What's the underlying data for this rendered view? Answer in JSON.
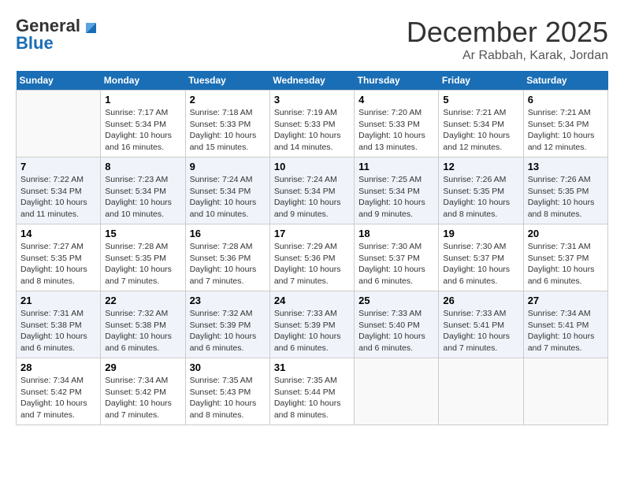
{
  "header": {
    "logo_general": "General",
    "logo_blue": "Blue",
    "month_title": "December 2025",
    "subtitle": "Ar Rabbah, Karak, Jordan"
  },
  "weekdays": [
    "Sunday",
    "Monday",
    "Tuesday",
    "Wednesday",
    "Thursday",
    "Friday",
    "Saturday"
  ],
  "weeks": [
    [
      {
        "day": "",
        "info": ""
      },
      {
        "day": "1",
        "info": "Sunrise: 7:17 AM\nSunset: 5:34 PM\nDaylight: 10 hours\nand 16 minutes."
      },
      {
        "day": "2",
        "info": "Sunrise: 7:18 AM\nSunset: 5:33 PM\nDaylight: 10 hours\nand 15 minutes."
      },
      {
        "day": "3",
        "info": "Sunrise: 7:19 AM\nSunset: 5:33 PM\nDaylight: 10 hours\nand 14 minutes."
      },
      {
        "day": "4",
        "info": "Sunrise: 7:20 AM\nSunset: 5:33 PM\nDaylight: 10 hours\nand 13 minutes."
      },
      {
        "day": "5",
        "info": "Sunrise: 7:21 AM\nSunset: 5:34 PM\nDaylight: 10 hours\nand 12 minutes."
      },
      {
        "day": "6",
        "info": "Sunrise: 7:21 AM\nSunset: 5:34 PM\nDaylight: 10 hours\nand 12 minutes."
      }
    ],
    [
      {
        "day": "7",
        "info": "Sunrise: 7:22 AM\nSunset: 5:34 PM\nDaylight: 10 hours\nand 11 minutes."
      },
      {
        "day": "8",
        "info": "Sunrise: 7:23 AM\nSunset: 5:34 PM\nDaylight: 10 hours\nand 10 minutes."
      },
      {
        "day": "9",
        "info": "Sunrise: 7:24 AM\nSunset: 5:34 PM\nDaylight: 10 hours\nand 10 minutes."
      },
      {
        "day": "10",
        "info": "Sunrise: 7:24 AM\nSunset: 5:34 PM\nDaylight: 10 hours\nand 9 minutes."
      },
      {
        "day": "11",
        "info": "Sunrise: 7:25 AM\nSunset: 5:34 PM\nDaylight: 10 hours\nand 9 minutes."
      },
      {
        "day": "12",
        "info": "Sunrise: 7:26 AM\nSunset: 5:35 PM\nDaylight: 10 hours\nand 8 minutes."
      },
      {
        "day": "13",
        "info": "Sunrise: 7:26 AM\nSunset: 5:35 PM\nDaylight: 10 hours\nand 8 minutes."
      }
    ],
    [
      {
        "day": "14",
        "info": "Sunrise: 7:27 AM\nSunset: 5:35 PM\nDaylight: 10 hours\nand 8 minutes."
      },
      {
        "day": "15",
        "info": "Sunrise: 7:28 AM\nSunset: 5:35 PM\nDaylight: 10 hours\nand 7 minutes."
      },
      {
        "day": "16",
        "info": "Sunrise: 7:28 AM\nSunset: 5:36 PM\nDaylight: 10 hours\nand 7 minutes."
      },
      {
        "day": "17",
        "info": "Sunrise: 7:29 AM\nSunset: 5:36 PM\nDaylight: 10 hours\nand 7 minutes."
      },
      {
        "day": "18",
        "info": "Sunrise: 7:30 AM\nSunset: 5:37 PM\nDaylight: 10 hours\nand 6 minutes."
      },
      {
        "day": "19",
        "info": "Sunrise: 7:30 AM\nSunset: 5:37 PM\nDaylight: 10 hours\nand 6 minutes."
      },
      {
        "day": "20",
        "info": "Sunrise: 7:31 AM\nSunset: 5:37 PM\nDaylight: 10 hours\nand 6 minutes."
      }
    ],
    [
      {
        "day": "21",
        "info": "Sunrise: 7:31 AM\nSunset: 5:38 PM\nDaylight: 10 hours\nand 6 minutes."
      },
      {
        "day": "22",
        "info": "Sunrise: 7:32 AM\nSunset: 5:38 PM\nDaylight: 10 hours\nand 6 minutes."
      },
      {
        "day": "23",
        "info": "Sunrise: 7:32 AM\nSunset: 5:39 PM\nDaylight: 10 hours\nand 6 minutes."
      },
      {
        "day": "24",
        "info": "Sunrise: 7:33 AM\nSunset: 5:39 PM\nDaylight: 10 hours\nand 6 minutes."
      },
      {
        "day": "25",
        "info": "Sunrise: 7:33 AM\nSunset: 5:40 PM\nDaylight: 10 hours\nand 6 minutes."
      },
      {
        "day": "26",
        "info": "Sunrise: 7:33 AM\nSunset: 5:41 PM\nDaylight: 10 hours\nand 7 minutes."
      },
      {
        "day": "27",
        "info": "Sunrise: 7:34 AM\nSunset: 5:41 PM\nDaylight: 10 hours\nand 7 minutes."
      }
    ],
    [
      {
        "day": "28",
        "info": "Sunrise: 7:34 AM\nSunset: 5:42 PM\nDaylight: 10 hours\nand 7 minutes."
      },
      {
        "day": "29",
        "info": "Sunrise: 7:34 AM\nSunset: 5:42 PM\nDaylight: 10 hours\nand 7 minutes."
      },
      {
        "day": "30",
        "info": "Sunrise: 7:35 AM\nSunset: 5:43 PM\nDaylight: 10 hours\nand 8 minutes."
      },
      {
        "day": "31",
        "info": "Sunrise: 7:35 AM\nSunset: 5:44 PM\nDaylight: 10 hours\nand 8 minutes."
      },
      {
        "day": "",
        "info": ""
      },
      {
        "day": "",
        "info": ""
      },
      {
        "day": "",
        "info": ""
      }
    ]
  ]
}
